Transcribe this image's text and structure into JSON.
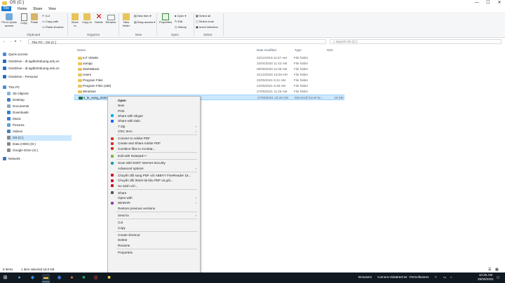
{
  "window": {
    "title": "OS (C:)",
    "controls": [
      "—",
      "☐",
      "✕"
    ]
  },
  "ribbon_tabs": [
    "File",
    "Home",
    "Share",
    "View"
  ],
  "ribbon": {
    "pin": "Pin to Quick access",
    "copy": "Copy",
    "paste": "Paste",
    "cut": "Cut",
    "copy_path": "Copy path",
    "paste_shortcut": "Paste shortcut",
    "move_to": "Move to",
    "copy_to": "Copy to",
    "delete": "Delete",
    "rename": "Rename",
    "new_folder": "New folder",
    "new_item": "New item",
    "easy_access": "Easy access",
    "properties": "Properties",
    "open": "Open",
    "edit": "Edit",
    "history": "History",
    "select_all": "Select all",
    "select_none": "Select none",
    "invert_selection": "Invert selection",
    "groups": [
      "Clipboard",
      "Organize",
      "New",
      "Open",
      "Select"
    ]
  },
  "address": {
    "path": "This PC  ›  OS (C:)",
    "search_placeholder": "Search OS (C:)"
  },
  "nav": {
    "items": [
      {
        "label": "Quick access"
      },
      {
        "label": "OneDrive - dt.sgdbinhduong.edu.vn"
      },
      {
        "label": "OneDrive - dt.sgdbinhduong.edu.vn"
      },
      {
        "label": "OneDrive - Personal"
      },
      {
        "label": "This PC"
      },
      {
        "label": "3D Objects"
      },
      {
        "label": "Desktop"
      },
      {
        "label": "Documents"
      },
      {
        "label": "Downloads"
      },
      {
        "label": "Music"
      },
      {
        "label": "Pictures"
      },
      {
        "label": "Videos"
      },
      {
        "label": "OS (C:)"
      },
      {
        "label": "Data (HDD) (D:)"
      },
      {
        "label": "Google Drive (G:)"
      },
      {
        "label": "Network"
      }
    ]
  },
  "columns": {
    "name": "Name",
    "date": "Date modified",
    "type": "Type",
    "size": "Size"
  },
  "files": [
    {
      "name": "IoT VEMIS",
      "date": "02/11/2019 11:57 AM",
      "type": "File folder",
      "size": ""
    },
    {
      "name": "xampp",
      "date": "22/04/2020 11:43 AM",
      "type": "File folder",
      "size": ""
    },
    {
      "name": "StartIsBack",
      "date": "06/08/2020 11:08 AM",
      "type": "File folder",
      "size": ""
    },
    {
      "name": "Users",
      "date": "31/10/2020 10:09 AM",
      "type": "File folder",
      "size": ""
    },
    {
      "name": "Program Files",
      "date": "22/05/2021 8:41 AM",
      "type": "File folder",
      "size": ""
    },
    {
      "name": "Program Files (x86)",
      "date": "22/05/2021 8:49 AM",
      "type": "File folder",
      "size": ""
    },
    {
      "name": "Windows",
      "date": "27/05/2021 11:26 AM",
      "type": "File folder",
      "size": ""
    },
    {
      "name": "ti_le_vang_2020",
      "date": "27/05/2021 10:40 AM",
      "type": "Microsoft Excel W...",
      "size": "19 KB"
    }
  ],
  "context_menu": {
    "items": [
      {
        "label": "Open",
        "bold": true
      },
      {
        "label": "New"
      },
      {
        "label": "Print"
      },
      {
        "label": "Share with Skype",
        "icon": "skype"
      },
      {
        "label": "Share with Zalo",
        "icon": "zalo"
      },
      {
        "label": "7-Zip",
        "submenu": true
      },
      {
        "label": "CRC SHA",
        "submenu": true
      },
      {
        "sep": true
      },
      {
        "label": "Convert to Adobe PDF",
        "icon": "pdf"
      },
      {
        "label": "Create and Share Adobe PDF",
        "icon": "pdf"
      },
      {
        "label": "Combine files in Acrobat...",
        "icon": "pdf"
      },
      {
        "sep": true
      },
      {
        "label": "Edit with Notepad++",
        "icon": "npp"
      },
      {
        "sep": true
      },
      {
        "label": "Scan with ESET Internet Security",
        "icon": "eset"
      },
      {
        "label": "Advanced options",
        "submenu": true
      },
      {
        "sep": true
      },
      {
        "label": "Chuyển đổi sang PDF với ABBYY FineReader 15...",
        "icon": "abbyy"
      },
      {
        "label": "Chuyển đổi thành tài liệu PDF và gửi...",
        "icon": "abbyy"
      },
      {
        "label": "So sánh với...",
        "icon": "abbyy"
      },
      {
        "sep": true
      },
      {
        "label": "Share",
        "icon": "share"
      },
      {
        "label": "Open with",
        "submenu": true
      },
      {
        "label": "WinRAR",
        "submenu": true,
        "icon": "winrar"
      },
      {
        "label": "Restore previous versions"
      },
      {
        "sep": true
      },
      {
        "label": "Send to",
        "submenu": true
      },
      {
        "sep": true
      },
      {
        "label": "Cut"
      },
      {
        "label": "Copy"
      },
      {
        "sep": true
      },
      {
        "label": "Create shortcut"
      },
      {
        "label": "Delete"
      },
      {
        "label": "Rename"
      },
      {
        "sep": true
      },
      {
        "label": "Properties"
      }
    ]
  },
  "status": {
    "items": "8 items",
    "selected": "1 item selected  18,0 KB"
  },
  "taskbar": {
    "tray_labels": [
      "Browsers",
      "Camera",
      "Video",
      "Internet",
      "VNI",
      "Softwares"
    ],
    "time": "10:35 AM",
    "date": "29/05/2021"
  },
  "colors": {
    "accent": "#1979ca",
    "selection": "#cce8ff",
    "taskbar": "#101820"
  }
}
